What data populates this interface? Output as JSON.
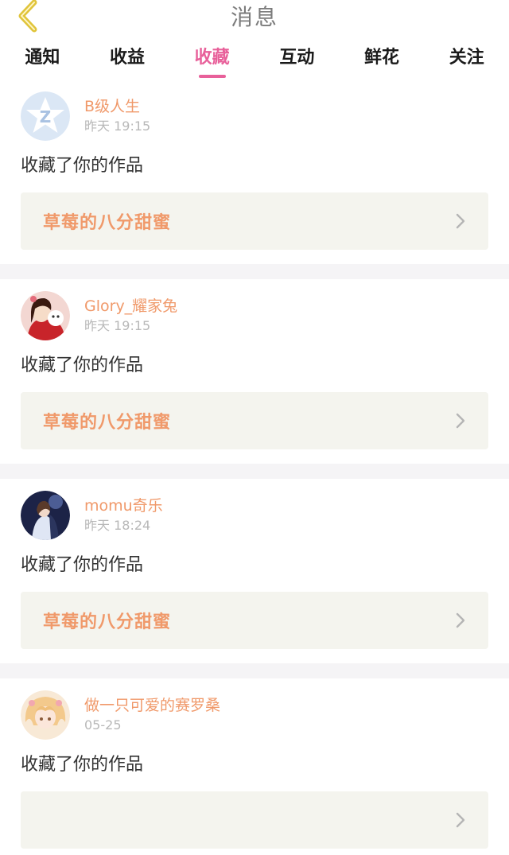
{
  "header": {
    "title": "消息",
    "back_icon": "chevron-left-icon",
    "back_color": "#e0c43a"
  },
  "tabs": [
    {
      "label": "通知",
      "active": false
    },
    {
      "label": "收益",
      "active": false
    },
    {
      "label": "收藏",
      "active": true
    },
    {
      "label": "互动",
      "active": false
    },
    {
      "label": "鲜花",
      "active": false
    },
    {
      "label": "关注",
      "active": false
    }
  ],
  "accent_color": "#e8609a",
  "name_color": "#f0996a",
  "messages": [
    {
      "user": "B级人生",
      "time": "昨天 19:15",
      "action": "收藏了你的作品",
      "work": "草莓的八分甜蜜",
      "avatar": "qq-star-avatar"
    },
    {
      "user": "Glory_耀家兔",
      "time": "昨天 19:15",
      "action": "收藏了你的作品",
      "work": "草莓的八分甜蜜",
      "avatar": "girl-red-avatar"
    },
    {
      "user": "momu奇乐",
      "time": "昨天 18:24",
      "action": "收藏了你的作品",
      "work": "草莓的八分甜蜜",
      "avatar": "couple-night-avatar"
    },
    {
      "user": "做一只可爱的赛罗桑",
      "time": "05-25",
      "action": "收藏了你的作品",
      "work": "",
      "avatar": "anime-girl-avatar"
    }
  ]
}
